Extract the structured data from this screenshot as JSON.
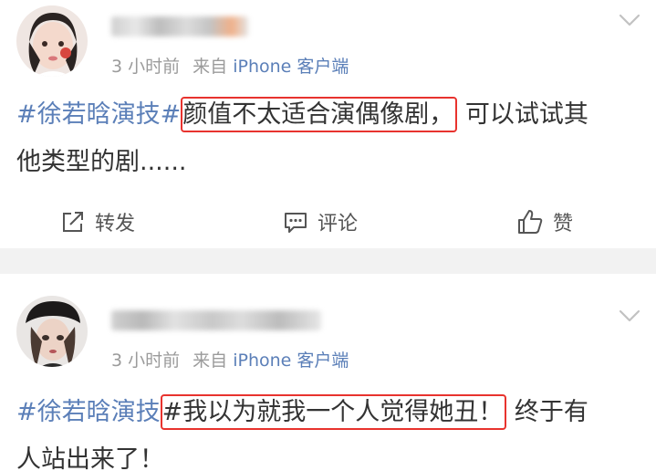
{
  "posts": [
    {
      "time": "3 小时前",
      "source_prefix": "来自",
      "source_name": "iPhone 客户端",
      "topic": "#徐若晗演技#",
      "highlighted": "颜值不太适合演偶像剧，",
      "rest_line1": "可以试试其",
      "rest_line2": "他类型的剧......"
    },
    {
      "time": "3 小时前",
      "source_prefix": "来自",
      "source_name": "iPhone 客户端",
      "topic": "#徐若晗演技",
      "highlighted": "#我以为就我一个人觉得她丑！",
      "rest_line1": "终于有",
      "rest_line2": "人站出来了！"
    }
  ],
  "actions": {
    "forward_label": "转发",
    "comment_label": "评论",
    "like_label": "赞"
  },
  "icons": {
    "forward": "share-icon",
    "comment": "comment-icon",
    "like": "thumbs-up-icon",
    "more": "chevron-down-icon"
  },
  "colors": {
    "topic": "#5b7fb8",
    "highlight_border": "#e8332e",
    "meta": "#9b9b9b",
    "separator": "#f2f2f2"
  }
}
